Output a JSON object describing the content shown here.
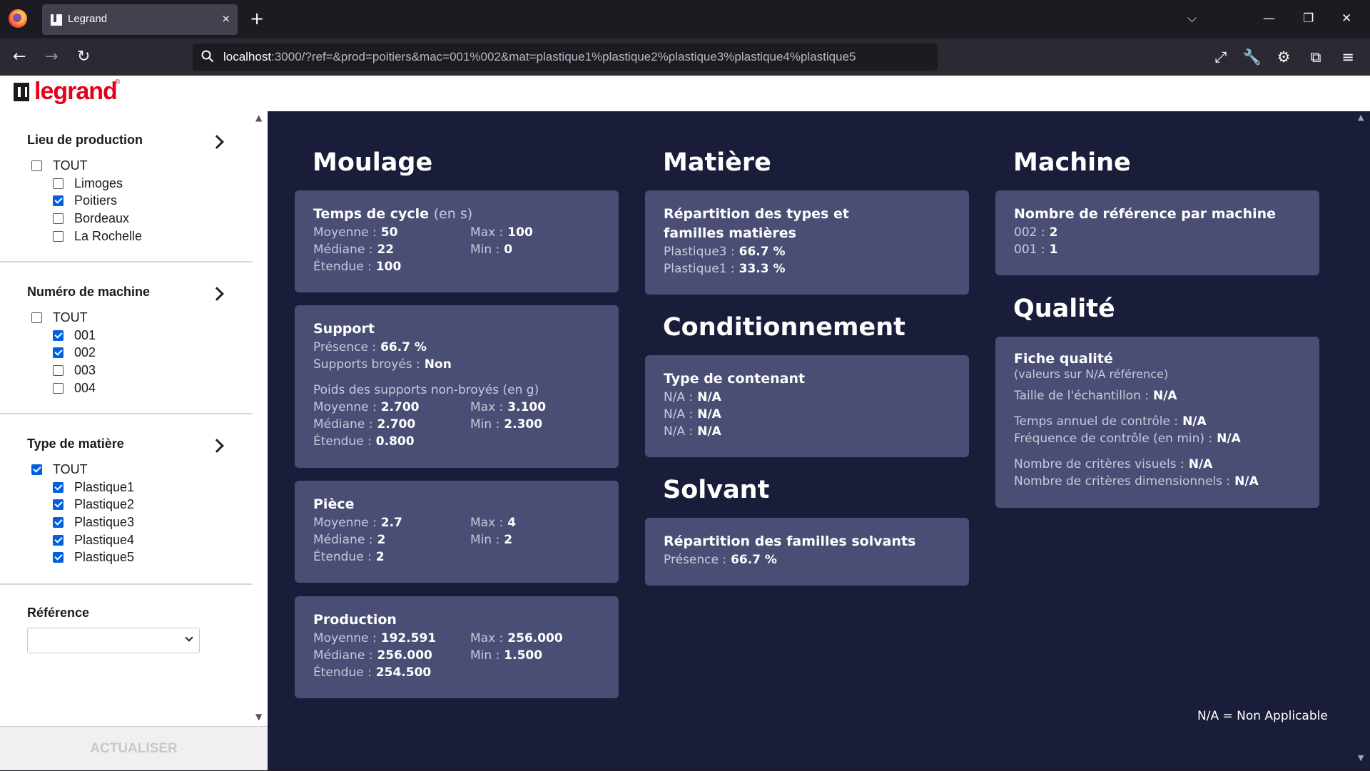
{
  "browser": {
    "tab_title": "Legrand",
    "tab_close": "×",
    "new_tab": "+",
    "url_host": "localhost",
    "url_rest": ":3000/?ref=&prod=poitiers&mac=001%002&mat=plastique1%plastique2%plastique3%plastique4%plastique5",
    "icons": [
      "back-icon",
      "forward-icon",
      "reload-icon",
      "search-icon",
      "fullscreen-icon",
      "wrench-icon",
      "gear-icon",
      "extensions-icon",
      "menu-icon"
    ]
  },
  "header": {
    "logo_text": "legrand",
    "logo_reg": "®"
  },
  "sidebar": {
    "production": {
      "title": "Lieu de production",
      "all": {
        "label": "TOUT",
        "checked": false
      },
      "items": [
        {
          "label": "Limoges",
          "checked": false
        },
        {
          "label": "Poitiers",
          "checked": true
        },
        {
          "label": "Bordeaux",
          "checked": false
        },
        {
          "label": "La Rochelle",
          "checked": false
        }
      ]
    },
    "machine": {
      "title": "Numéro de machine",
      "all": {
        "label": "TOUT",
        "checked": false
      },
      "items": [
        {
          "label": "001",
          "checked": true
        },
        {
          "label": "002",
          "checked": true
        },
        {
          "label": "003",
          "checked": false
        },
        {
          "label": "004",
          "checked": false
        }
      ]
    },
    "material": {
      "title": "Type de matière",
      "all": {
        "label": "TOUT",
        "checked": true
      },
      "items": [
        {
          "label": "Plastique1",
          "checked": true
        },
        {
          "label": "Plastique2",
          "checked": true
        },
        {
          "label": "Plastique3",
          "checked": true
        },
        {
          "label": "Plastique4",
          "checked": true
        },
        {
          "label": "Plastique5",
          "checked": true
        }
      ]
    },
    "reference": {
      "title": "Référence",
      "value": ""
    },
    "refresh_label": "ACTUALISER"
  },
  "main": {
    "moulage": {
      "title": "Moulage",
      "cycle": {
        "title": "Temps de cycle",
        "unit": "(en s)",
        "moyenne_label": "Moyenne :",
        "moyenne": "50",
        "max_label": "Max :",
        "max": "100",
        "mediane_label": "Médiane :",
        "mediane": "22",
        "min_label": "Min :",
        "min": "0",
        "etendue_label": "Étendue :",
        "etendue": "100"
      },
      "support": {
        "title": "Support",
        "presence_label": "Présence :",
        "presence": "66.7 %",
        "broyes_label": "Supports broyés :",
        "broyes": "Non",
        "poids_label": "Poids des supports non-broyés (en g)",
        "moyenne_label": "Moyenne :",
        "moyenne": "2.700",
        "max_label": "Max :",
        "max": "3.100",
        "mediane_label": "Médiane :",
        "mediane": "2.700",
        "min_label": "Min :",
        "min": "2.300",
        "etendue_label": "Étendue :",
        "etendue": "0.800"
      },
      "piece": {
        "title": "Pièce",
        "moyenne_label": "Moyenne :",
        "moyenne": "2.7",
        "max_label": "Max :",
        "max": "4",
        "mediane_label": "Médiane :",
        "mediane": "2",
        "min_label": "Min :",
        "min": "2",
        "etendue_label": "Étendue :",
        "etendue": "2"
      },
      "production": {
        "title": "Production",
        "moyenne_label": "Moyenne :",
        "moyenne": "192.591",
        "max_label": "Max :",
        "max": "256.000",
        "mediane_label": "Médiane :",
        "mediane": "256.000",
        "min_label": "Min :",
        "min": "1.500",
        "etendue_label": "Étendue :",
        "etendue": "254.500"
      }
    },
    "matiere": {
      "title": "Matière",
      "card_title": "Répartition des types et familles matières",
      "rows": [
        {
          "label": "Plastique3 :",
          "value": "66.7 %"
        },
        {
          "label": "Plastique1 :",
          "value": "33.3 %"
        }
      ]
    },
    "conditionnement": {
      "title": "Conditionnement",
      "card_title": "Type de contenant",
      "rows": [
        {
          "label": "N/A :",
          "value": "N/A"
        },
        {
          "label": "N/A :",
          "value": "N/A"
        },
        {
          "label": "N/A :",
          "value": "N/A"
        }
      ]
    },
    "solvant": {
      "title": "Solvant",
      "card_title": "Répartition des familles solvants",
      "presence_label": "Présence :",
      "presence": "66.7 %"
    },
    "machine": {
      "title": "Machine",
      "card_title": "Nombre de référence par machine",
      "rows": [
        {
          "label": "002 :",
          "value": "2"
        },
        {
          "label": "001 :",
          "value": "1"
        }
      ]
    },
    "qualite": {
      "title": "Qualité",
      "card_title": "Fiche qualité",
      "card_sub": "(valeurs sur N/A référence)",
      "taille_label": "Taille de l'échantillon :",
      "taille": "N/A",
      "temps_label": "Temps annuel de contrôle :",
      "temps": "N/A",
      "freq_label": "Fréquence de contrôle (en min) :",
      "freq": "N/A",
      "visuels_label": "Nombre de critères visuels :",
      "visuels": "N/A",
      "dim_label": "Nombre de critères dimensionnels :",
      "dim": "N/A"
    },
    "legend_note": "N/A = Non Applicable"
  },
  "colors": {
    "main_bg": "#1a1d3a",
    "card_bg": "#4a4e74",
    "brand": "#e2001a",
    "checkbox": "#0060df"
  }
}
